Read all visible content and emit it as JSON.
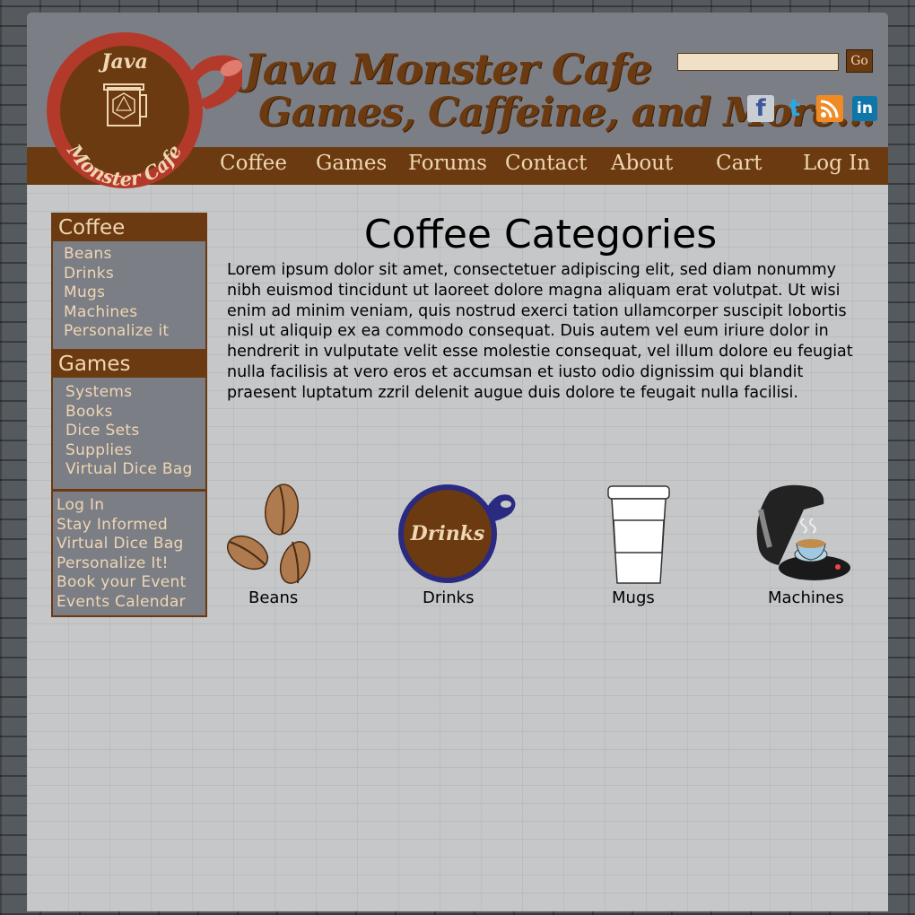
{
  "header": {
    "logo_text_top": "Java",
    "logo_text_bottom": "Monster Cafe",
    "title": "Java Monster Cafe",
    "tagline": "Games, Caffeine, and More...",
    "search": {
      "value": "",
      "placeholder": "",
      "button_label": "Go"
    },
    "social": [
      {
        "name": "facebook",
        "glyph": "f"
      },
      {
        "name": "twitter",
        "glyph": "t"
      },
      {
        "name": "rss",
        "glyph": "rss"
      },
      {
        "name": "linkedin",
        "glyph": "in"
      }
    ]
  },
  "nav": {
    "items": [
      "Coffee",
      "Games",
      "Forums",
      "Contact",
      "About",
      "Cart",
      "Log In"
    ]
  },
  "sidebar": {
    "coffee": {
      "title": "Coffee",
      "items": [
        "Beans",
        "Drinks",
        "Mugs",
        "Machines",
        "Personalize it"
      ]
    },
    "games": {
      "title": "Games",
      "items": [
        "Systems",
        "Books",
        "Dice Sets",
        "Supplies",
        "Virtual Dice Bag"
      ]
    },
    "account": {
      "items": [
        "Log In",
        "Stay Informed",
        "Virtual Dice Bag",
        "Personalize It!",
        "Book your Event",
        "Events Calendar"
      ]
    }
  },
  "main": {
    "title": "Coffee Categories",
    "body": "Lorem ipsum dolor sit amet, consectetuer adipiscing elit, sed diam nonummy nibh euismod tincidunt ut laoreet dolore magna aliquam erat volutpat. Ut wisi enim ad minim veniam, quis nostrud exerci tation ullamcorper suscipit lobortis nisl ut aliquip ex ea commodo consequat. Duis autem vel eum iriure dolor in hendrerit in vulputate velit esse molestie consequat, vel illum dolore eu feugiat nulla facilisis at vero eros et accumsan et iusto odio dignissim qui blandit praesent luptatum zzril delenit augue duis dolore te feugait nulla facilisi.",
    "categories": [
      {
        "label": "Beans",
        "icon": "coffee-beans-icon"
      },
      {
        "label": "Drinks",
        "icon": "coffee-cup-icon",
        "icon_text": "Drinks"
      },
      {
        "label": "Mugs",
        "icon": "paper-cup-icon"
      },
      {
        "label": "Machines",
        "icon": "coffee-machine-icon"
      }
    ]
  },
  "colors": {
    "brand_brown": "#6b3a10",
    "nav_text": "#efd6b4",
    "header_gray": "#7c7e85",
    "logo_red": "#b33a2a",
    "content_bg": "#c6c7c9"
  }
}
